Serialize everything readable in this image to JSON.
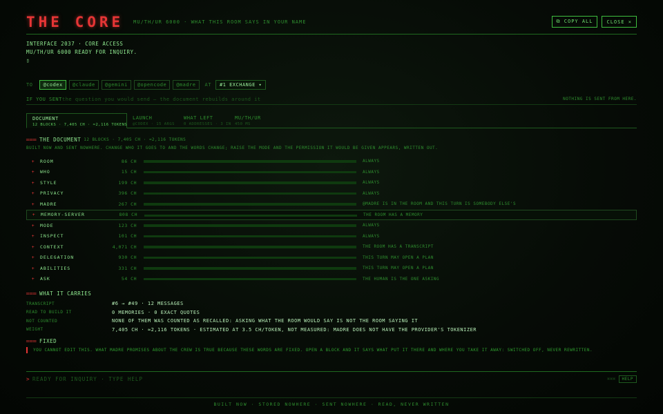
{
  "header": {
    "logo": "THE CORE",
    "subtitle": "MU/TH/UR 6000 · WHAT THIS ROOM SAYS IN YOUR NAME",
    "copy_label": "⧉ COPY ALL",
    "close_label": "CLOSE ×"
  },
  "intro": {
    "line1": "INTERFACE 2037 · CORE ACCESS",
    "line2": "MU/TH/UR 6000 READY FOR INQUIRY.",
    "cursor": "▯"
  },
  "to_row": {
    "to_label": "TO",
    "recipients": [
      "@codex",
      "@claude",
      "@gemini",
      "@opencode",
      "@madre"
    ],
    "active": "@codex",
    "at_label": "AT",
    "exchange": "#1 EXCHANGE ▾"
  },
  "if_row": {
    "label": "IF YOU SENT",
    "placeholder": "the question you would send — the document rebuilds around it",
    "note": "NOTHING IS SENT FROM HERE."
  },
  "tabs": [
    {
      "title": "DOCUMENT",
      "sub": "12 BLOCKS · 7,405 CH · ≈2,116 TOKENS",
      "active": true
    },
    {
      "title": "LAUNCH",
      "sub": "@codex · 15 ARGS",
      "active": false
    },
    {
      "title": "WHAT LEFT",
      "sub": "0 ADDRESSES · 3 IN",
      "active": false
    },
    {
      "title": "MU/TH/UR",
      "sub": "450 MS",
      "active": false
    }
  ],
  "document": {
    "arrow": "═══",
    "title": "THE DOCUMENT",
    "meta": "12 BLOCKS · 7,405 CH · ≈2,116 TOKENS",
    "desc": "BUILT NOW AND SENT NOWHERE. CHANGE WHO IT GOES TO AND THE WORDS CHANGE; RAISE THE MODE AND THE PERMISSION IT WOULD BE GIVEN APPEARS, WRITTEN OUT.",
    "blocks": [
      {
        "name": "ROOM",
        "chars": 86,
        "size": "86 CH",
        "when": "ALWAYS"
      },
      {
        "name": "WHO",
        "chars": 15,
        "size": "15 CH",
        "when": "ALWAYS"
      },
      {
        "name": "STYLE",
        "chars": 199,
        "size": "199 CH",
        "when": "ALWAYS"
      },
      {
        "name": "PRIVACY",
        "chars": 396,
        "size": "396 CH",
        "when": "ALWAYS"
      },
      {
        "name": "MADRE",
        "chars": 267,
        "size": "267 CH",
        "when": "@MADRE IS IN THE ROOM AND THIS TURN IS SOMEBODY ELSE'S"
      },
      {
        "name": "MEMORY-SERVER",
        "chars": 808,
        "size": "808 CH",
        "when": "THE ROOM HAS A MEMORY"
      },
      {
        "name": "MODE",
        "chars": 123,
        "size": "123 CH",
        "when": "ALWAYS"
      },
      {
        "name": "INSPECT",
        "chars": 101,
        "size": "101 CH",
        "when": "ALWAYS"
      },
      {
        "name": "CONTEXT",
        "chars": 4071,
        "size": "4,071 CH",
        "when": "THE ROOM HAS A TRANSCRIPT"
      },
      {
        "name": "DELEGATION",
        "chars": 930,
        "size": "930 CH",
        "when": "THIS TURN MAY OPEN A PLAN"
      },
      {
        "name": "ABILITIES",
        "chars": 331,
        "size": "331 CH",
        "when": "THIS TURN MAY OPEN A PLAN"
      },
      {
        "name": "ASK",
        "chars": 54,
        "size": "54 CH",
        "when": "THE HUMAN IS THE ONE ASKING"
      }
    ]
  },
  "carries": {
    "title": "WHAT IT CARRIES",
    "rows": [
      {
        "key": "TRANSCRIPT",
        "value": "#6 → #49 · 12 MESSAGES"
      },
      {
        "key": "READ TO BUILD IT",
        "value": "0 MEMORIES · 0 EXACT QUOTES"
      },
      {
        "key": "NOT COUNTED",
        "value": "NONE OF THEM WAS COUNTED AS RECALLED: ASKING WHAT THE ROOM WOULD SAY IS NOT THE ROOM SAYING IT"
      },
      {
        "key": "WEIGHT",
        "value": "7,405 CH · ≈2,116 TOKENS · ESTIMATED AT 3.5 CH/TOKEN, NOT MEASURED: MADRE DOES NOT HAVE THE PROVIDER'S TOKENIZER"
      }
    ]
  },
  "fixed": {
    "title": "FIXED",
    "text": "YOU CANNOT EDIT THIS. WHAT MADRE PROMISES ABOUT THE CREW IS TRUE BECAUSE THESE WORDS ARE FIXED. OPEN A BLOCK AND IT SAYS WHAT PUT IT THERE AND WHERE YOU TAKE IT AWAY: SWITCHED OFF, NEVER REWRITTEN."
  },
  "prompt": {
    "caret": ">",
    "placeholder": "READY FOR INQUIRY · TYPE HELP",
    "shortcut": "⌘⌘⌘",
    "help_label": "HELP"
  },
  "footer": "BUILT NOW · STORED NOWHERE · SENT NOWHERE · READ, NEVER WRITTEN",
  "colors": {
    "background": "#050a05",
    "text": "#3fbf3f",
    "accent_red": "#e53535",
    "bar": "#c9a83b"
  }
}
